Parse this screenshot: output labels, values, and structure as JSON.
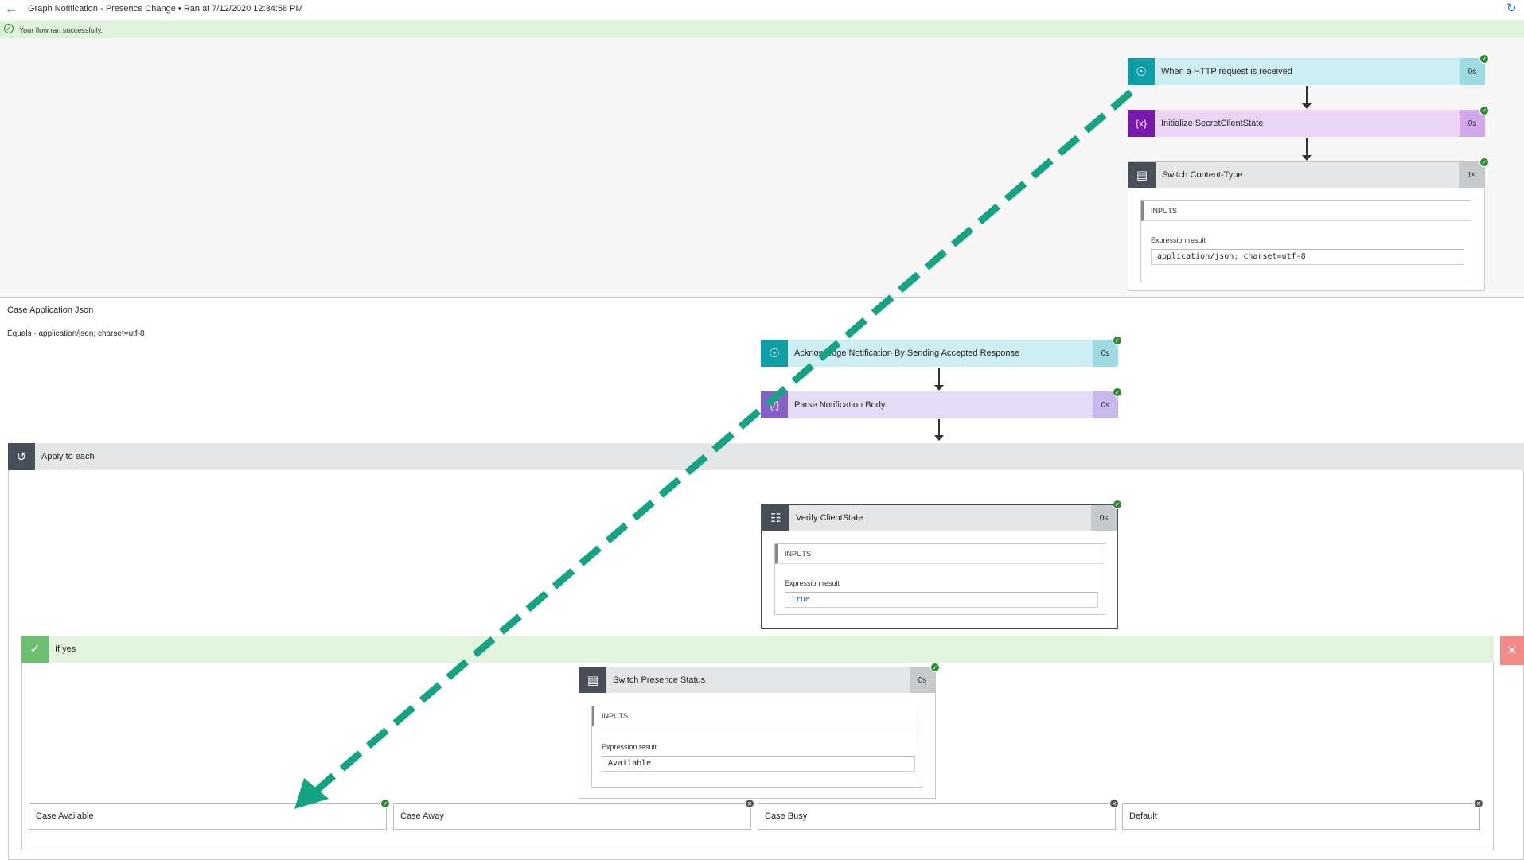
{
  "header": {
    "run_title": "Graph Notification - Presence Change • Ran at 7/12/2020 12:34:58 PM",
    "back_icon": "arrow-left-icon",
    "refresh_icon": "refresh-icon"
  },
  "banner": {
    "text": "Your flow ran successfully."
  },
  "actions": {
    "http": {
      "title": "When a HTTP request is received",
      "duration": "0s"
    },
    "init": {
      "title": "Initialize SecretClientState",
      "duration": "0s"
    },
    "switch_ct": {
      "title": "Switch Content-Type",
      "duration": "1s",
      "inputs_label": "INPUTS",
      "expr_label": "Expression result",
      "expr_value": "application/json; charset=utf-8"
    },
    "ack": {
      "title": "Acknowledge Notification By Sending Accepted Response",
      "duration": "0s"
    },
    "parse": {
      "title": "Parse Notification Body",
      "duration": "0s"
    },
    "verify": {
      "title": "Verify ClientState",
      "duration": "0s",
      "inputs_label": "INPUTS",
      "expr_label": "Expression result",
      "expr_value": "true"
    },
    "switch_ps": {
      "title": "Switch Presence Status",
      "duration": "0s",
      "inputs_label": "INPUTS",
      "expr_label": "Expression result",
      "expr_value": "Available"
    }
  },
  "case_scope": {
    "title": "Case Application Json",
    "subtitle": "Equals - application/json; charset=utf-8"
  },
  "apply_each": {
    "title": "Apply to each"
  },
  "if_yes": {
    "title": "If yes"
  },
  "cases": [
    {
      "label": "Case Available",
      "status": "succeeded"
    },
    {
      "label": "Case Away",
      "status": "skipped"
    },
    {
      "label": "Case Busy",
      "status": "skipped"
    },
    {
      "label": "Default",
      "status": "skipped"
    }
  ],
  "colors": {
    "http_accent": "#0f9ea6",
    "http_bg": "#cdeef2",
    "var_accent": "#7719aa",
    "var_bg": "#ebd5f5",
    "parse_accent": "#8661c5",
    "parse_bg": "#e4dcf5",
    "control_accent": "#484f58",
    "control_bg": "#e4e6e8",
    "success": "#2d8a33",
    "annotation_arrow": "#14a383"
  }
}
